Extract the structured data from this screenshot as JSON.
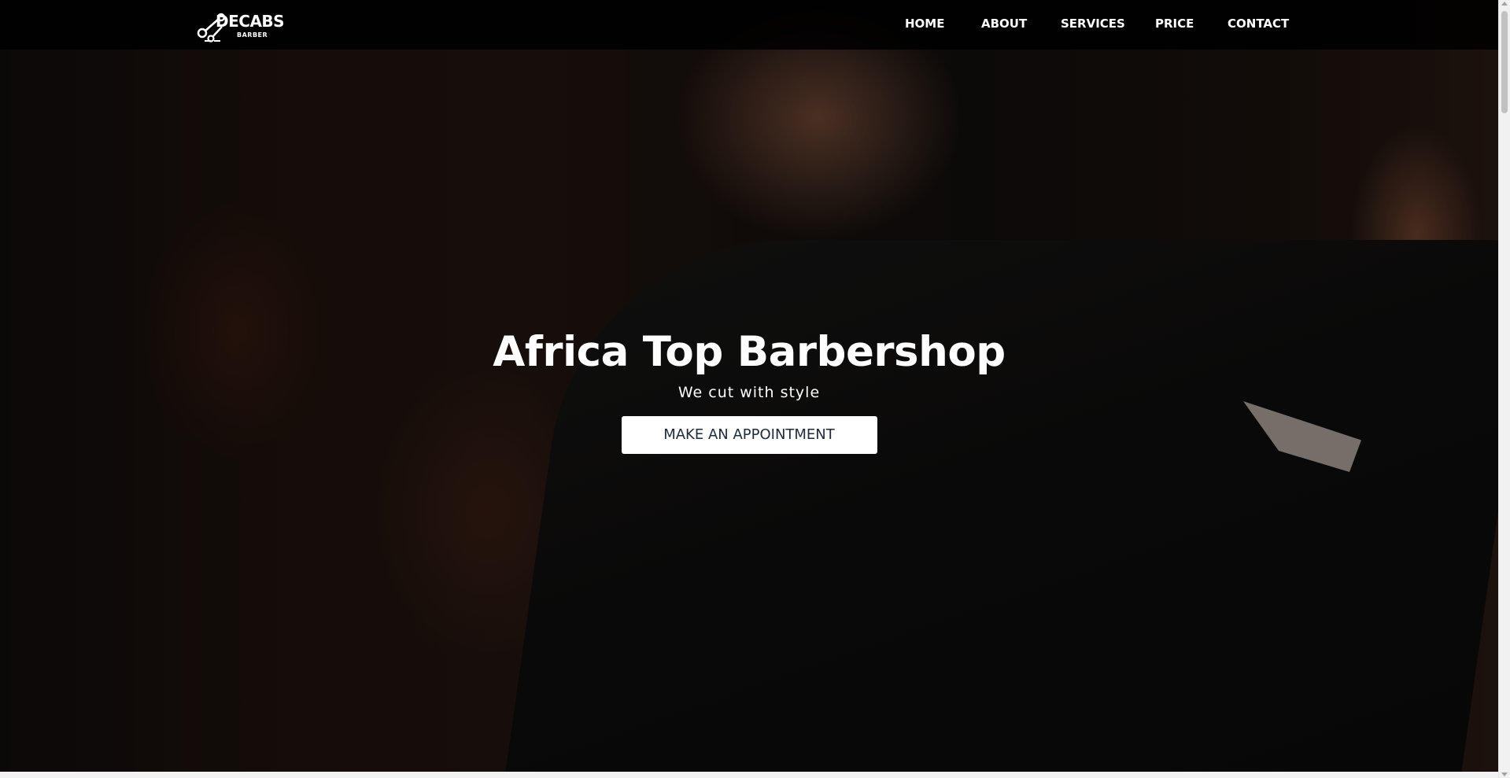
{
  "brand": {
    "name": "DECABS",
    "tagline": "BARBER"
  },
  "nav": {
    "items": [
      {
        "label": "HOME"
      },
      {
        "label": "ABOUT"
      },
      {
        "label": "SERVICES"
      },
      {
        "label": "PRICE"
      },
      {
        "label": "CONTACT"
      }
    ]
  },
  "hero": {
    "title": "Africa Top Barbershop",
    "subtitle": "We cut with style",
    "cta_label": "MAKE AN APPOINTMENT"
  },
  "colors": {
    "navbar_bg": "#000000",
    "cta_bg": "#ffffff",
    "cta_text": "#1f2a3a",
    "text": "#ffffff"
  },
  "icons": {
    "logo_icon": "scissors-icon"
  }
}
